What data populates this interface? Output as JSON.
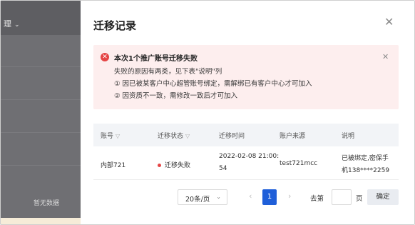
{
  "background": {
    "menu_label": "理",
    "empty_text": "暂无数据"
  },
  "modal": {
    "title": "迁移记录",
    "alert": {
      "icon": "✕",
      "title": "本次1个推广账号迁移失败",
      "lines": [
        "失败的原因有两类，见下表\"说明\"列",
        "① 因已被某客户中心超管账号绑定，需解绑已有客户中心才可加入",
        "② 因资质不一致，需修改一致后才可加入"
      ]
    },
    "table": {
      "columns": [
        "账号",
        "迁移状态",
        "迁移时间",
        "账户来源",
        "说明"
      ],
      "rows": [
        {
          "account": "内部721",
          "status": "迁移失败",
          "time_line1": "2022-02-08 21:00:",
          "time_line2": "54",
          "source": "test721mcc",
          "note_line1": "已被绑定,密保手",
          "note_line2": "机138****2259"
        }
      ]
    },
    "pagination": {
      "page_size": "20条/页",
      "current_page": "1",
      "goto_label": "去第",
      "goto_unit": "页",
      "confirm": "确定"
    }
  },
  "colors": {
    "primary": "#1f5fd9",
    "error": "#e54545",
    "alert_bg": "#fdeeee"
  }
}
